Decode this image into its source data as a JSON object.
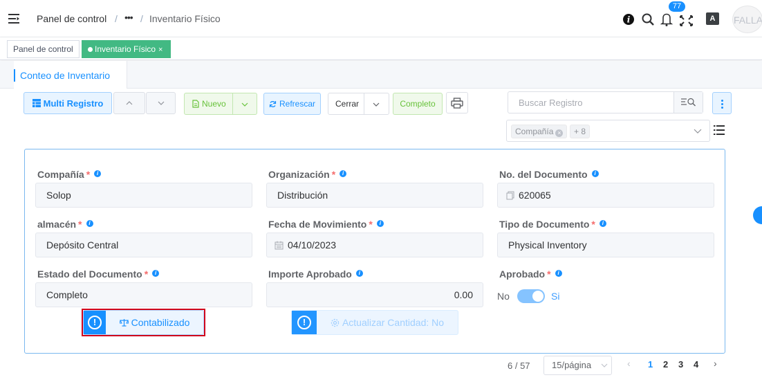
{
  "header": {
    "breadcrumb": [
      "Panel de control",
      "•••",
      "Inventario Físico"
    ],
    "breadcrumb_sep": "/",
    "notification_count": "77",
    "translate_icon_text": "A",
    "avatar_text": "FALLA"
  },
  "tags": {
    "items": [
      {
        "label": "Panel de control"
      },
      {
        "label": "Inventario Físico",
        "close": "×"
      }
    ]
  },
  "tab": {
    "label": "Conteo de Inventario"
  },
  "toolbar": {
    "multi_registro": "Multi Registro",
    "nuevo": "Nuevo",
    "refrescar": "Refrescar",
    "cerrar": "Cerrar",
    "completo": "Completo",
    "search_placeholder": "Buscar Registro",
    "filter_chip": "Compañía",
    "filter_more": "+ 8"
  },
  "form": {
    "compania": {
      "label": "Compañía",
      "value": "Solop"
    },
    "organizacion": {
      "label": "Organización",
      "value": "Distribución"
    },
    "no_documento": {
      "label": "No. del Documento",
      "value": "620065"
    },
    "almacen": {
      "label": "almacén",
      "value": "Depósito Central"
    },
    "fecha_movimiento": {
      "label": "Fecha de Movimiento",
      "value": "04/10/2023"
    },
    "tipo_documento": {
      "label": "Tipo de Documento",
      "value": "Physical Inventory"
    },
    "estado_documento": {
      "label": "Estado del Documento",
      "value": "Completo"
    },
    "importe_aprobado": {
      "label": "Importe Aprobado",
      "value": "0.00"
    },
    "aprobado": {
      "label": "Aprobado",
      "off_label": "No",
      "on_label": "Si",
      "checked": true
    },
    "contabilizado_button": "Contabilizado",
    "actualizar_button": "Actualizar Cantidad: No"
  },
  "pagination": {
    "position": "6 / 57",
    "page_size": "15/página",
    "pages": [
      "1",
      "2",
      "3",
      "4"
    ],
    "current_page": "1"
  },
  "colors": {
    "primary": "#1890ff",
    "success": "#42b983",
    "highlight": "#d0021b"
  }
}
